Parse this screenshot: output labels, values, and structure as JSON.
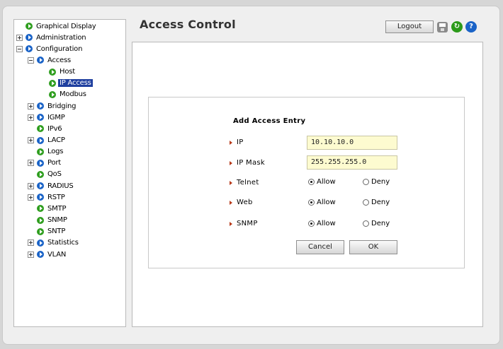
{
  "page_title": "Access Control",
  "toolbar": {
    "logout_label": "Logout",
    "help_glyph": "?"
  },
  "tree": [
    {
      "label": "Graphical Display",
      "expander": "none",
      "icon": "green",
      "level": 0
    },
    {
      "label": "Administration",
      "expander": "plus",
      "icon": "blue",
      "level": 0
    },
    {
      "label": "Configuration",
      "expander": "minus",
      "icon": "blue",
      "level": 0
    },
    {
      "label": "Access",
      "expander": "minus",
      "icon": "blue",
      "level": 1
    },
    {
      "label": "Host",
      "expander": "none",
      "icon": "green",
      "level": 2
    },
    {
      "label": "IP Access",
      "expander": "none",
      "icon": "green",
      "level": 2,
      "selected": true
    },
    {
      "label": "Modbus",
      "expander": "none",
      "icon": "green",
      "level": 2
    },
    {
      "label": "Bridging",
      "expander": "plus",
      "icon": "blue",
      "level": 1
    },
    {
      "label": "IGMP",
      "expander": "plus",
      "icon": "blue",
      "level": 1
    },
    {
      "label": "IPv6",
      "expander": "none",
      "icon": "green",
      "level": 1
    },
    {
      "label": "LACP",
      "expander": "plus",
      "icon": "blue",
      "level": 1
    },
    {
      "label": "Logs",
      "expander": "none",
      "icon": "green",
      "level": 1
    },
    {
      "label": "Port",
      "expander": "plus",
      "icon": "blue",
      "level": 1
    },
    {
      "label": "QoS",
      "expander": "none",
      "icon": "green",
      "level": 1
    },
    {
      "label": "RADIUS",
      "expander": "plus",
      "icon": "blue",
      "level": 1
    },
    {
      "label": "RSTP",
      "expander": "plus",
      "icon": "blue",
      "level": 1
    },
    {
      "label": "SMTP",
      "expander": "none",
      "icon": "green",
      "level": 1
    },
    {
      "label": "SNMP",
      "expander": "none",
      "icon": "green",
      "level": 1
    },
    {
      "label": "SNTP",
      "expander": "none",
      "icon": "green",
      "level": 1
    },
    {
      "label": "Statistics",
      "expander": "plus",
      "icon": "blue",
      "level": 1
    },
    {
      "label": "VLAN",
      "expander": "plus",
      "icon": "blue",
      "level": 1
    }
  ],
  "form": {
    "title": "Add Access Entry",
    "ip_label": "IP",
    "ip_value": "10.10.10.0",
    "mask_label": "IP Mask",
    "mask_value": "255.255.255.0",
    "telnet_label": "Telnet",
    "web_label": "Web",
    "snmp_label": "SNMP",
    "allow_label": "Allow",
    "deny_label": "Deny",
    "telnet_selected": "Allow",
    "web_selected": "Allow",
    "snmp_selected": "Allow",
    "cancel_label": "Cancel",
    "ok_label": "OK"
  }
}
